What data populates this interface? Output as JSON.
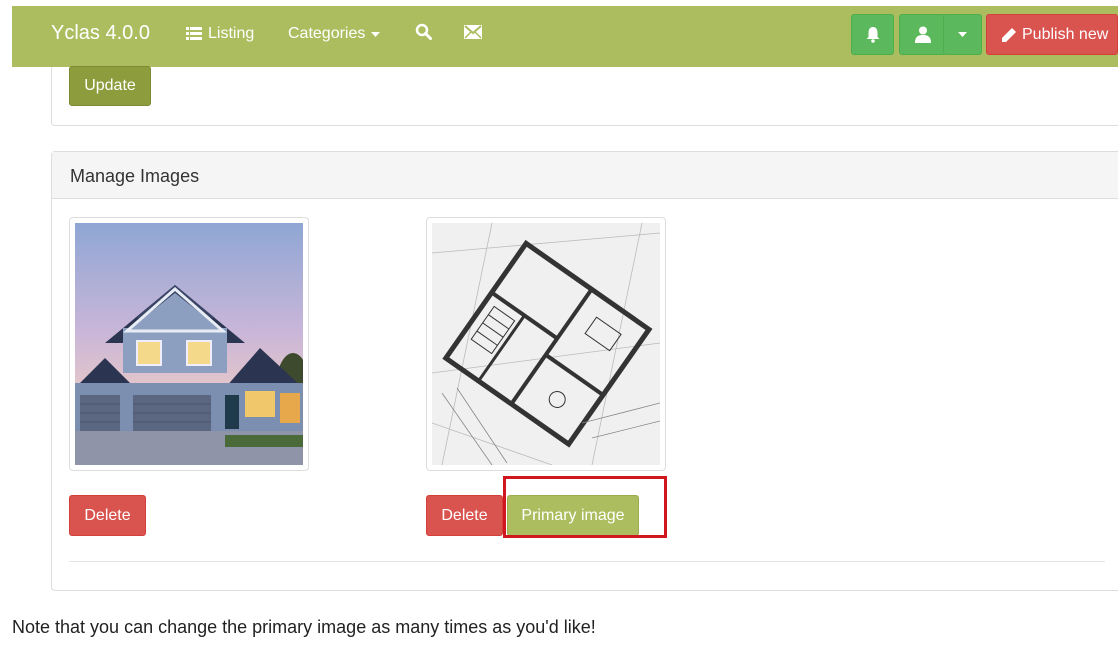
{
  "navbar": {
    "brand": "Yclas 4.0.0",
    "listing_label": "Listing",
    "categories_label": "Categories",
    "publish_label": "Publish new"
  },
  "top_panel": {
    "update_label": "Update"
  },
  "manage_images": {
    "title": "Manage Images",
    "images": [
      {
        "alt": "house-photo",
        "delete_label": "Delete"
      },
      {
        "alt": "floor-plan-photo",
        "delete_label": "Delete",
        "primary_label": "Primary image"
      }
    ]
  },
  "note": "Note that you can change the primary image as many times as you'd like!",
  "colors": {
    "navbar": "#acbd5f",
    "green": "#5cb85c",
    "red": "#d9534f",
    "highlight": "#d0161f"
  }
}
